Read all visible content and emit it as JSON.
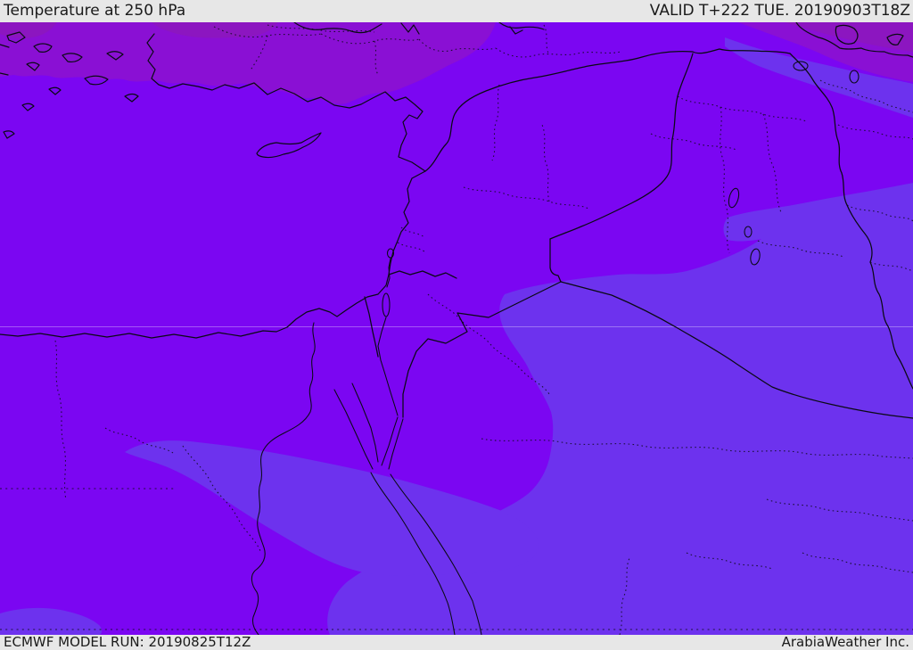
{
  "header": {
    "title": "Temperature at 250 hPa",
    "valid_label": "VALID T+222 TUE. 20190903T18Z"
  },
  "footer": {
    "model_run_label": "ECMWF MODEL RUN: 20190825T12Z",
    "provider_label": "ArabiaWeather Inc."
  },
  "map": {
    "colors": {
      "violet_main": "#7B06F2",
      "purple_warm": "#8A10D4",
      "purple_warmest": "#8C16C0",
      "blue_cool": "#6D32EE",
      "line_dark": "#0A0A14",
      "graticule": "rgba(255,255,255,0.32)",
      "bar_bg": "#E7E7E7",
      "bar_text": "#1A1A1A"
    }
  }
}
